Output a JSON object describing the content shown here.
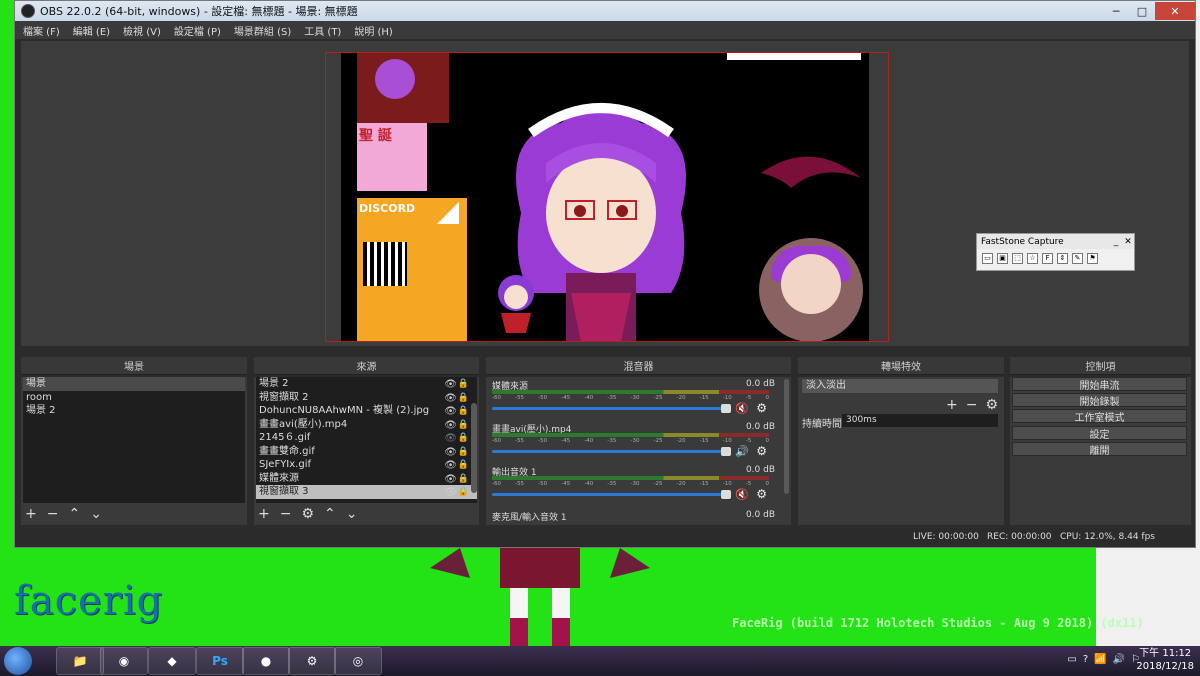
{
  "window": {
    "title": "OBS 22.0.2 (64-bit, windows) - 設定檔: 無標題 - 場景: 無標題",
    "minimize": "─",
    "maximize": "□",
    "close": "✕"
  },
  "menu": [
    "檔案 (F)",
    "編輯 (E)",
    "檢視 (V)",
    "設定檔 (P)",
    "場景群組 (S)",
    "工具 (T)",
    "說明 (H)"
  ],
  "preview": {
    "thumb2_text": "聖\n誕",
    "discord_label": "DISCORD"
  },
  "scenes": {
    "title": "場景",
    "items": [
      "場景",
      "room",
      "場景 2"
    ],
    "selected_index": 0
  },
  "sources": {
    "title": "來源",
    "items": [
      "場景 2",
      "視窗擷取 2",
      "DohuncNU8AAhwMN - 複製 (2).jpg",
      "畫畫avi(壓小).mp4",
      "2145６.gif",
      "畫畫雙命.gif",
      "SJeFYIx.gif",
      "媒體來源",
      "視窗擷取 3"
    ],
    "highlighted_index": 8
  },
  "mixer": {
    "title": "混音器",
    "ticks": [
      "-60",
      "-55",
      "-50",
      "-45",
      "-40",
      "-35",
      "-30",
      "-25",
      "-20",
      "-15",
      "-10",
      "-5",
      "0"
    ],
    "channels": [
      {
        "name": "媒體來源",
        "db": "0.0 dB",
        "muted": true
      },
      {
        "name": "畫畫avi(壓小).mp4",
        "db": "0.0 dB",
        "muted": false
      },
      {
        "name": "輸出音效 1",
        "db": "0.0 dB",
        "muted": true
      },
      {
        "name": "麥克風/輸入音效 1",
        "db": "0.0 dB",
        "muted": false
      }
    ]
  },
  "transitions": {
    "title": "轉場特效",
    "selected": "淡入淡出",
    "duration_label": "持續時間",
    "duration_value": "300ms"
  },
  "controls": {
    "title": "控制項",
    "buttons": [
      "開始串流",
      "開始錄製",
      "工作室模式",
      "設定",
      "離開"
    ]
  },
  "status": {
    "live": "LIVE: 00:00:00",
    "rec": "REC: 00:00:00",
    "cpu": "CPU: 12.0%, 8.44 fps"
  },
  "faststone": {
    "title": "FastStone Capture",
    "min": "_",
    "close": "✕"
  },
  "facerig": {
    "logo": "facerig",
    "build": "FaceRig (build 1712 Holotech Studios - Aug  9 2018) (dx11)"
  },
  "taskbar": {
    "apps": [
      "explorer-icon",
      "chrome-icon",
      "blender-icon",
      "photoshop-icon",
      "obs-icon",
      "steam-icon",
      "facerig-icon"
    ],
    "ps_label": "Ps",
    "clock_ampm_time": "下午 11:12",
    "clock_date": "2018/12/18"
  },
  "colors": {
    "green_screen": "#23e216",
    "obs_bg": "#2b2b2b",
    "preview_border": "#c02020",
    "volume_bar": "#2a7bd6"
  }
}
